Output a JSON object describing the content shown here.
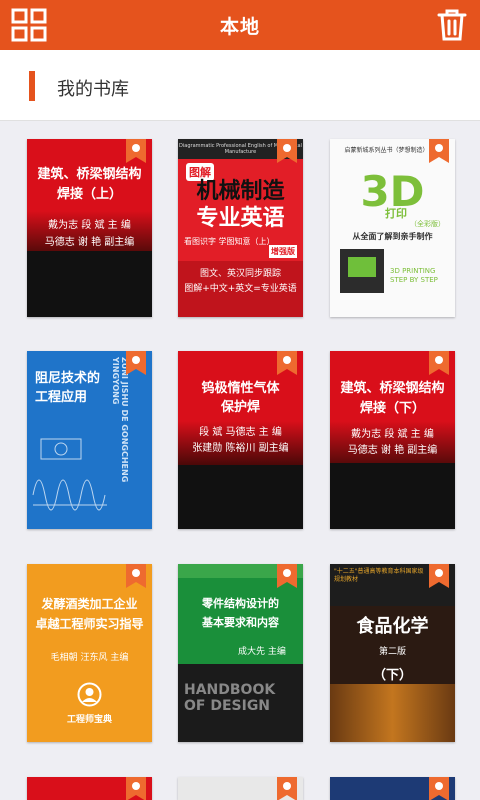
{
  "header": {
    "title": "本地",
    "grid_icon": "grid-icon",
    "trash_icon": "trash-icon",
    "bg_color": "#e5531d"
  },
  "library": {
    "title": "我的书库"
  },
  "books": [
    {
      "name": "book-jianzhu-qiaoliang-shang",
      "title_lines": [
        "建筑、桥梁钢结构",
        "焊接（上）"
      ],
      "author_lines": [
        "戴为志  段  斌  主  编",
        "马德志  谢  艳  副主编"
      ]
    },
    {
      "name": "book-jixie-zhizao",
      "top_text": "Diagrammatic Professional English of Mechanical Manufacture",
      "tag": "图解",
      "title_lines": [
        "机械制造",
        "专业英语"
      ],
      "sub_lines": [
        "看图识字 学图知意（上）",
        "增强版"
      ],
      "desc_lines": [
        "图文、英汉同步跟踪",
        "图解+中文+英文=专业英语"
      ]
    },
    {
      "name": "book-3d-printing",
      "top_text": "启蒙新城系列丛书（梦想制造）系列",
      "title_main": "3D",
      "title_sub": "打印",
      "edition": "（全彩版）",
      "subtitle": "从全面了解到亲手制作",
      "eng_lines": [
        "3D PRINTING",
        "STEP BY STEP"
      ]
    },
    {
      "name": "book-zuni-jishu",
      "title_lines": [
        "阻尼技术的",
        "工程应用"
      ],
      "side_text": "ZUNI JISHU DE GONGCHENG YINGYONG"
    },
    {
      "name": "book-wuji-duoxing-qiti",
      "title_lines": [
        "钨极惰性气体",
        "保护焊"
      ],
      "author_lines": [
        "段  斌  马德志  主  编",
        "张建勋  陈裕川  副主编"
      ]
    },
    {
      "name": "book-jianzhu-qiaoliang-xia",
      "title_lines": [
        "建筑、桥梁钢结构",
        "焊接（下）"
      ],
      "author_lines": [
        "戴为志  段  斌  主  编",
        "马德志  谢  艳  副主编"
      ]
    },
    {
      "name": "book-fajiao-jiu",
      "title_lines": [
        "发酵酒类加工企业",
        "卓越工程师实习指导"
      ],
      "author_lines": [
        "毛相朝  汪东风  主编"
      ],
      "series": "工程师宝典"
    },
    {
      "name": "book-lingjian-jiegou",
      "title_lines": [
        "零件结构设计的",
        "基本要求和内容"
      ],
      "author_lines": [
        "成大先  主编"
      ],
      "eng_lines": [
        "HANDBOOK",
        "OF DESIGN"
      ]
    },
    {
      "name": "book-shipin-huaxue",
      "top_text": "\"十二五\"普通高等教育本科国家级规划教材",
      "title_main": "食品化学",
      "edition": "第二版",
      "volume": "（下）"
    }
  ]
}
